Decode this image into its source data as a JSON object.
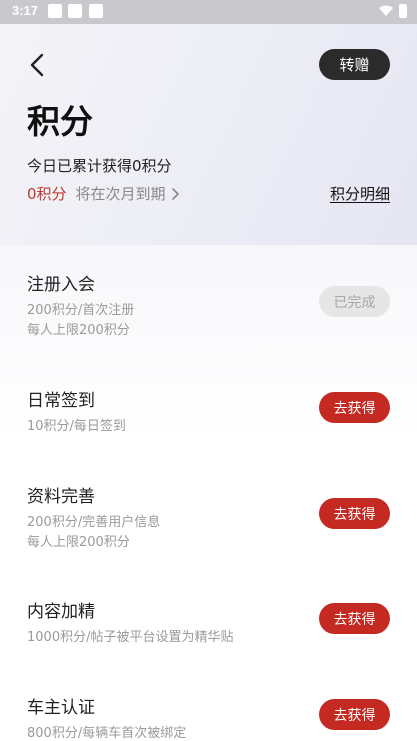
{
  "status": {
    "time": "3:17"
  },
  "header": {
    "transfer_label": "转赠",
    "title": "积分",
    "today_text": "今日已累计获得0积分",
    "points_value": "0积分",
    "expiry_text": "将在次月到期",
    "detail_link": "积分明细"
  },
  "tasks": [
    {
      "title": "注册入会",
      "line1": "200积分/首次注册",
      "line2": "每人上限200积分",
      "button": "已完成",
      "state": "done"
    },
    {
      "title": "日常签到",
      "line1": "10积分/每日签到",
      "line2": "",
      "button": "去获得",
      "state": "active"
    },
    {
      "title": "资料完善",
      "line1": "200积分/完善用户信息",
      "line2": "每人上限200积分",
      "button": "去获得",
      "state": "active"
    },
    {
      "title": "内容加精",
      "line1": "1000积分/帖子被平台设置为精华贴",
      "line2": "",
      "button": "去获得",
      "state": "active"
    },
    {
      "title": "车主认证",
      "line1": "800积分/每辆车首次被绑定",
      "line2": "",
      "button": "去获得",
      "state": "active"
    }
  ],
  "colors": {
    "accent": "#c42a22",
    "dark_button": "#2b2b2b"
  },
  "icons": {
    "back": "chevron-left-icon",
    "expiry": "chevron-right-icon"
  }
}
